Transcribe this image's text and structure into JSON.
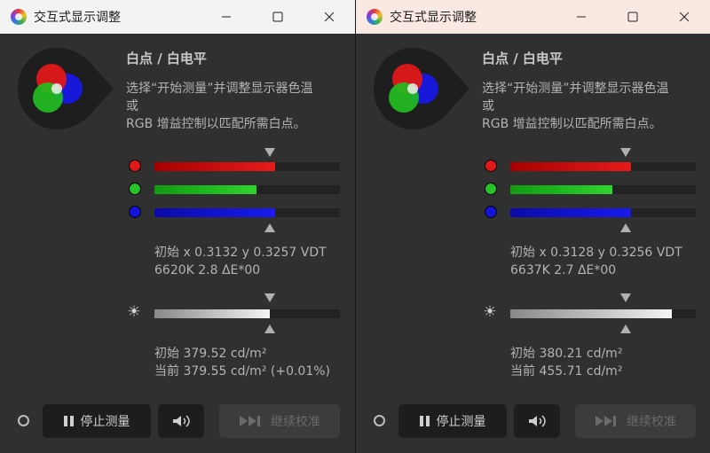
{
  "windows": [
    {
      "id": "left",
      "title": "交互式显示调整",
      "heading": "白点 / 白电平",
      "description": [
        "选择“开始测量”并调整显示器色温",
        "或",
        "RGB 增益控制以匹配所需白点。"
      ],
      "rgb_gains": {
        "red": 0.65,
        "green": 0.55,
        "blue": 0.65
      },
      "whitepoint": [
        "初始 x 0.3132 y 0.3257 VDT",
        "6620K 2.8 ΔE*00"
      ],
      "luminance_level": 0.62,
      "luminance": [
        "初始 379.52 cd/m²",
        "当前 379.55 cd/m² (+0.01%)"
      ],
      "buttons": {
        "stop": "停止测量",
        "continue": "继续校准"
      }
    },
    {
      "id": "right",
      "title": "交互式显示调整",
      "heading": "白点 / 白电平",
      "description": [
        "选择“开始测量”并调整显示器色温",
        "或",
        "RGB 增益控制以匹配所需白点。"
      ],
      "rgb_gains": {
        "red": 0.65,
        "green": 0.55,
        "blue": 0.65
      },
      "whitepoint": [
        "初始 x 0.3128 y 0.3256 VDT",
        "6637K 2.7 ΔE*00"
      ],
      "luminance_level": 0.87,
      "luminance": [
        "初始 380.21 cd/m²",
        "当前 455.71 cd/m²"
      ],
      "buttons": {
        "stop": "停止测量",
        "continue": "继续校准"
      }
    }
  ],
  "icons": [
    "app-icon",
    "minimize-icon",
    "maximize-icon",
    "close-icon",
    "brightness-icon",
    "pause-icon",
    "speaker-icon",
    "skip-forward-icon",
    "status-ring-icon"
  ],
  "colors": {
    "red": "#e01818",
    "green": "#26c426",
    "blue": "#1414d8",
    "panel": "#303030",
    "button": "#1d1d1d"
  }
}
